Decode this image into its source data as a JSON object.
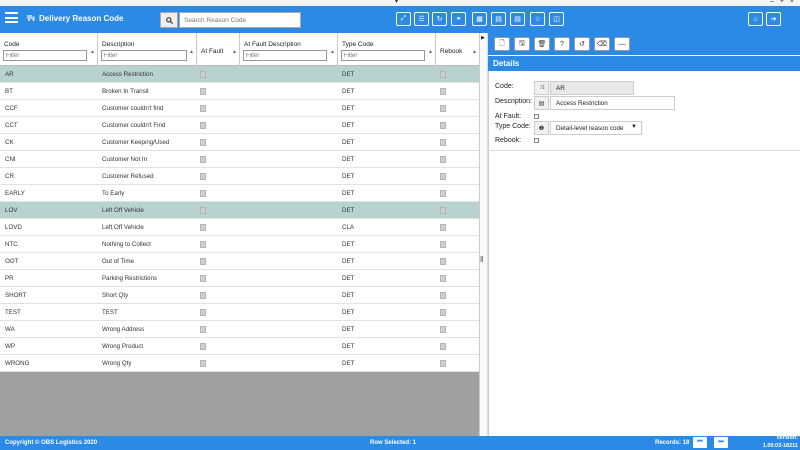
{
  "window": {
    "collapse_glyph": "▾",
    "controls": "– + ×"
  },
  "header": {
    "title": "Delivery Reason Code",
    "title_icon": "truck-icon",
    "search": {
      "placeholder": "Search Reason Code",
      "value": ""
    },
    "toolbar_icons": [
      "expand-icon",
      "database-icon",
      "refresh-icon",
      "link-icon",
      "table-icon",
      "document-icon",
      "document-icon",
      "star-icon",
      "columns-icon"
    ],
    "right_icons": [
      "home-icon",
      "logout-icon"
    ]
  },
  "grid": {
    "columns": [
      {
        "label": "Code",
        "filter_placeholder": "Filter"
      },
      {
        "label": "Description",
        "filter_placeholder": "Filter"
      },
      {
        "label": "At Fault"
      },
      {
        "label": "At Fault Description",
        "filter_placeholder": "Filter"
      },
      {
        "label": "Type Code",
        "filter_placeholder": "Filter"
      },
      {
        "label": "Rebook"
      }
    ],
    "rows": [
      {
        "code": "AR",
        "description": "Access Restriction",
        "type": "DET",
        "selected": true
      },
      {
        "code": "BT",
        "description": "Broken In Transit",
        "type": "DET"
      },
      {
        "code": "CCF",
        "description": "Customer couldn't find",
        "type": "DET"
      },
      {
        "code": "CCT",
        "description": "Customer couldn't Find",
        "type": "DET"
      },
      {
        "code": "CK",
        "description": "Customer Keeping/Used",
        "type": "DET"
      },
      {
        "code": "CNI",
        "description": "Customer Not In",
        "type": "DET"
      },
      {
        "code": "CR",
        "description": "Customer Refused",
        "type": "DET"
      },
      {
        "code": "EARLY",
        "description": "To Early",
        "type": "DET"
      },
      {
        "code": "LOV",
        "description": "Left Off Vehicle",
        "type": "DET",
        "highlight": true
      },
      {
        "code": "LOVD",
        "description": "Left Off Vehicle",
        "type": "CLA"
      },
      {
        "code": "NTC",
        "description": "Nothing to Collect",
        "type": "DET"
      },
      {
        "code": "OOT",
        "description": "Out of Time",
        "type": "DET"
      },
      {
        "code": "PR",
        "description": "Parking Restrictions",
        "type": "DET"
      },
      {
        "code": "SHORT",
        "description": "Short Qty",
        "type": "DET"
      },
      {
        "code": "TEST",
        "description": "TEST",
        "type": "DET"
      },
      {
        "code": "WA",
        "description": "Wrong Address",
        "type": "DET"
      },
      {
        "code": "WP",
        "description": "Wrong Product",
        "type": "DET"
      },
      {
        "code": "WRONG",
        "description": "Wrong Qty",
        "type": "DET"
      }
    ]
  },
  "details": {
    "title": "Details",
    "toolbar_icons": [
      "new-icon",
      "save-icon",
      "delete-icon",
      "help-icon",
      "undo-icon",
      "eraser-icon",
      "minus-icon"
    ],
    "code_label": "Code:",
    "code_value": "AR",
    "description_label": "Description:",
    "description_value": "Access Restriction",
    "at_fault_label": "At Fault:",
    "type_code_label": "Type Code:",
    "type_code_value": "Detail-level reason code",
    "rebook_label": "Rebook:"
  },
  "footer": {
    "copyright": "Copyright © OBS Logistics 2020",
    "row_selected": "Row Selected: 1",
    "records": "Records: 18",
    "version_label": "Version:",
    "version_value": "1.00.03-18211"
  },
  "colors": {
    "accent": "#2b8ae6",
    "selected_row": "#b8d2d2",
    "grid_empty": "#a0a0a0"
  }
}
